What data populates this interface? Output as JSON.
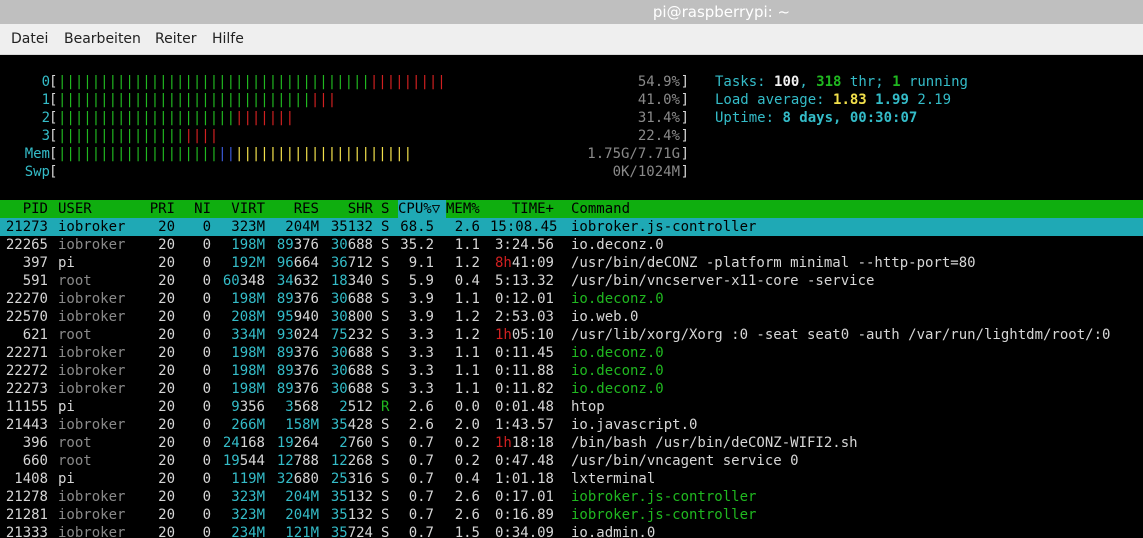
{
  "window": {
    "title": "pi@raspberrypi: ~"
  },
  "menu": [
    "Datei",
    "Bearbeiten",
    "Reiter",
    "Hilfe"
  ],
  "meters": {
    "cpu": [
      {
        "label": "0",
        "green": 37,
        "red": 9,
        "percent": "54.9%"
      },
      {
        "label": "1",
        "green": 30,
        "red": 3,
        "percent": "41.0%"
      },
      {
        "label": "2",
        "green": 21,
        "red": 7,
        "percent": "31.4%"
      },
      {
        "label": "3",
        "green": 15,
        "red": 4,
        "percent": "22.4%"
      }
    ],
    "mem": {
      "label": "Mem",
      "green": 19,
      "blue": 2,
      "yellow": 21,
      "value": "1.75G/7.71G"
    },
    "swp": {
      "label": "Swp",
      "value": "0K/1024M"
    }
  },
  "summary": {
    "tasks_label": "Tasks:",
    "tasks": "100",
    "thr": "318",
    "thr_label": "thr;",
    "running": "1",
    "running_label": "running",
    "load_label": "Load average:",
    "load1": "1.83",
    "load5": "1.99",
    "load15": "2.19",
    "uptime_label": "Uptime:",
    "uptime": "8 days, 00:30:07"
  },
  "columns": [
    "PID",
    "USER",
    "PRI",
    "NI",
    "VIRT",
    "RES",
    "SHR",
    "S",
    "CPU%▽",
    "MEM%",
    "TIME+",
    "Command"
  ],
  "processes": [
    {
      "pid": "21273",
      "user": "iobroker",
      "pri": "20",
      "ni": "0",
      "virt": "323M",
      "res": "204M",
      "shr": "35132",
      "s": "S",
      "cpu": "68.5",
      "mem": "2.6",
      "time": "15:08.45",
      "cmd": "iobroker.js-controller",
      "selected": true
    },
    {
      "pid": "22265",
      "user": "iobroker",
      "pri": "20",
      "ni": "0",
      "virt": "198M",
      "res": "89376",
      "shr": "30688",
      "s": "S",
      "cpu": "35.2",
      "mem": "1.1",
      "time": "3:24.56",
      "cmd": "io.deconz.0"
    },
    {
      "pid": "397",
      "user": "pi",
      "pri": "20",
      "ni": "0",
      "virt": "192M",
      "res": "96664",
      "shr": "36712",
      "s": "S",
      "cpu": "9.1",
      "mem": "1.2",
      "time": "8h41:09",
      "cmd": "/usr/bin/deCONZ -platform minimal --http-port=80"
    },
    {
      "pid": "591",
      "user": "root",
      "pri": "20",
      "ni": "0",
      "virt": "60348",
      "res": "34632",
      "shr": "18340",
      "s": "S",
      "cpu": "5.9",
      "mem": "0.4",
      "time": "5:13.32",
      "cmd": "/usr/bin/vncserver-x11-core -service"
    },
    {
      "pid": "22270",
      "user": "iobroker",
      "pri": "20",
      "ni": "0",
      "virt": "198M",
      "res": "89376",
      "shr": "30688",
      "s": "S",
      "cpu": "3.9",
      "mem": "1.1",
      "time": "0:12.01",
      "cmd": "io.deconz.0",
      "thread": true
    },
    {
      "pid": "22570",
      "user": "iobroker",
      "pri": "20",
      "ni": "0",
      "virt": "208M",
      "res": "95940",
      "shr": "30800",
      "s": "S",
      "cpu": "3.9",
      "mem": "1.2",
      "time": "2:53.03",
      "cmd": "io.web.0"
    },
    {
      "pid": "621",
      "user": "root",
      "pri": "20",
      "ni": "0",
      "virt": "334M",
      "res": "93024",
      "shr": "75232",
      "s": "S",
      "cpu": "3.3",
      "mem": "1.2",
      "time": "1h05:10",
      "cmd": "/usr/lib/xorg/Xorg :0 -seat seat0 -auth /var/run/lightdm/root/:0"
    },
    {
      "pid": "22271",
      "user": "iobroker",
      "pri": "20",
      "ni": "0",
      "virt": "198M",
      "res": "89376",
      "shr": "30688",
      "s": "S",
      "cpu": "3.3",
      "mem": "1.1",
      "time": "0:11.45",
      "cmd": "io.deconz.0",
      "thread": true
    },
    {
      "pid": "22272",
      "user": "iobroker",
      "pri": "20",
      "ni": "0",
      "virt": "198M",
      "res": "89376",
      "shr": "30688",
      "s": "S",
      "cpu": "3.3",
      "mem": "1.1",
      "time": "0:11.88",
      "cmd": "io.deconz.0",
      "thread": true
    },
    {
      "pid": "22273",
      "user": "iobroker",
      "pri": "20",
      "ni": "0",
      "virt": "198M",
      "res": "89376",
      "shr": "30688",
      "s": "S",
      "cpu": "3.3",
      "mem": "1.1",
      "time": "0:11.82",
      "cmd": "io.deconz.0",
      "thread": true
    },
    {
      "pid": "11155",
      "user": "pi",
      "pri": "20",
      "ni": "0",
      "virt": "9356",
      "res": "3568",
      "shr": "2512",
      "s": "R",
      "cpu": "2.6",
      "mem": "0.0",
      "time": "0:01.48",
      "cmd": "htop"
    },
    {
      "pid": "21443",
      "user": "iobroker",
      "pri": "20",
      "ni": "0",
      "virt": "266M",
      "res": "158M",
      "shr": "35428",
      "s": "S",
      "cpu": "2.6",
      "mem": "2.0",
      "time": "1:43.57",
      "cmd": "io.javascript.0"
    },
    {
      "pid": "396",
      "user": "root",
      "pri": "20",
      "ni": "0",
      "virt": "24168",
      "res": "19264",
      "shr": "2760",
      "s": "S",
      "cpu": "0.7",
      "mem": "0.2",
      "time": "1h18:18",
      "cmd": "/bin/bash /usr/bin/deCONZ-WIFI2.sh"
    },
    {
      "pid": "660",
      "user": "root",
      "pri": "20",
      "ni": "0",
      "virt": "19544",
      "res": "12788",
      "shr": "12268",
      "s": "S",
      "cpu": "0.7",
      "mem": "0.2",
      "time": "0:47.48",
      "cmd": "/usr/bin/vncagent service 0"
    },
    {
      "pid": "1408",
      "user": "pi",
      "pri": "20",
      "ni": "0",
      "virt": "119M",
      "res": "32680",
      "shr": "25316",
      "s": "S",
      "cpu": "0.7",
      "mem": "0.4",
      "time": "1:01.18",
      "cmd": "lxterminal"
    },
    {
      "pid": "21278",
      "user": "iobroker",
      "pri": "20",
      "ni": "0",
      "virt": "323M",
      "res": "204M",
      "shr": "35132",
      "s": "S",
      "cpu": "0.7",
      "mem": "2.6",
      "time": "0:17.01",
      "cmd": "iobroker.js-controller",
      "thread": true
    },
    {
      "pid": "21281",
      "user": "iobroker",
      "pri": "20",
      "ni": "0",
      "virt": "323M",
      "res": "204M",
      "shr": "35132",
      "s": "S",
      "cpu": "0.7",
      "mem": "2.6",
      "time": "0:16.89",
      "cmd": "iobroker.js-controller",
      "thread": true
    },
    {
      "pid": "21333",
      "user": "iobroker",
      "pri": "20",
      "ni": "0",
      "virt": "234M",
      "res": "121M",
      "shr": "35724",
      "s": "S",
      "cpu": "0.7",
      "mem": "1.5",
      "time": "0:34.09",
      "cmd": "io.admin.0"
    }
  ],
  "colors": {
    "header_bg": "#0fae0f",
    "selected_bg": "#1fa9b5",
    "cyan": "#34bcc8",
    "green": "#20b820",
    "red": "#d12020",
    "yellow": "#f2e04b"
  }
}
